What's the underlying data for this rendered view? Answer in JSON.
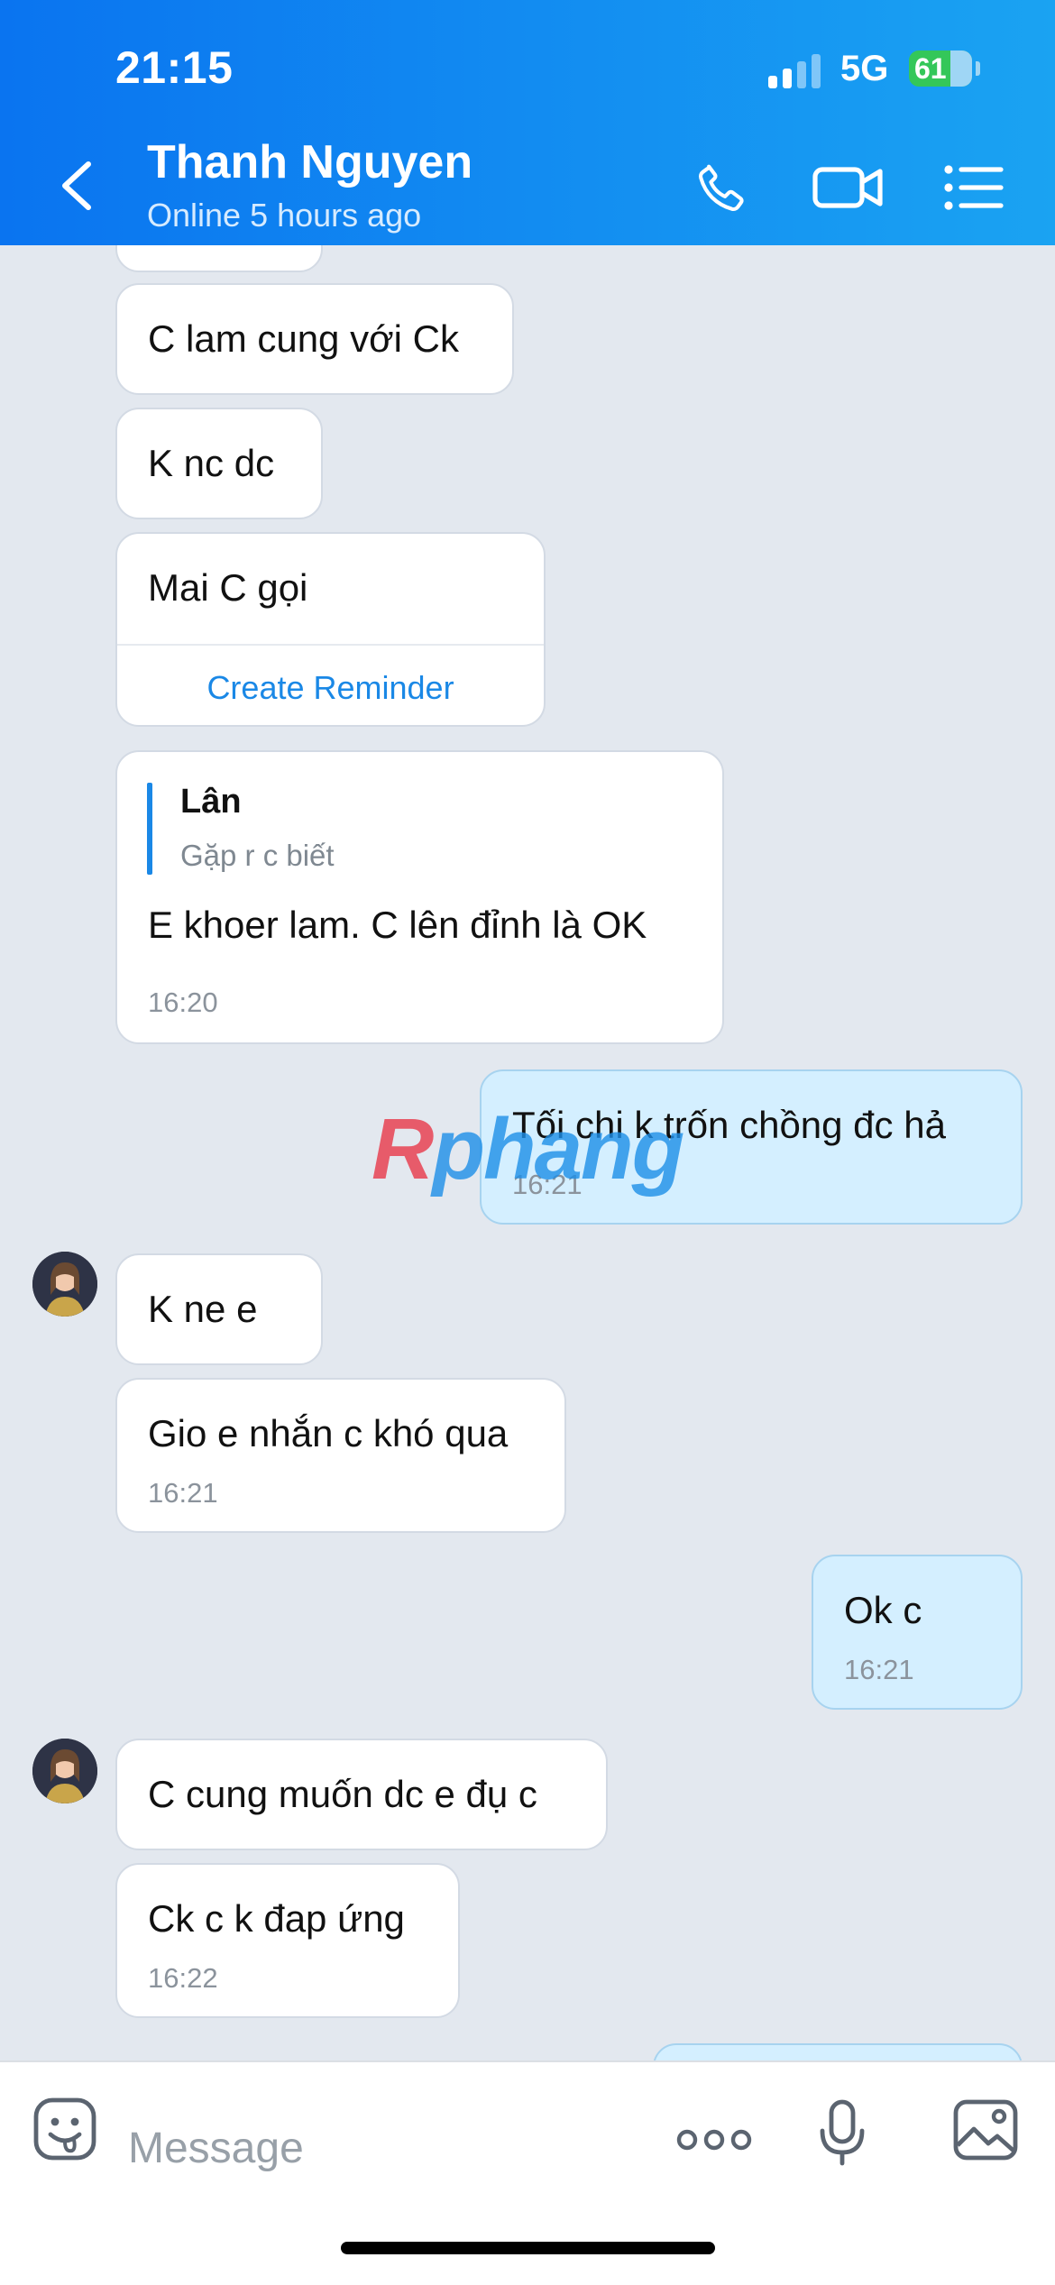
{
  "status_bar": {
    "time": "21:15",
    "network": "5G",
    "battery": "61"
  },
  "header": {
    "contact_name": "Thanh Nguyen",
    "status": "Online 5 hours ago",
    "icons": [
      "back-icon",
      "phone-icon",
      "video-call-icon",
      "menu-list-icon"
    ]
  },
  "messages": [
    {
      "text": "C lam cung với Ck"
    },
    {
      "text": "K nc dc"
    },
    {
      "text": "Mai C gọi",
      "action": "Create Reminder"
    },
    {
      "quote_name": "Lân",
      "quote_text": "Gặp r c biết",
      "text": "E khoer lam.  C lên đỉnh là OK",
      "time": "16:20"
    },
    {
      "text": "Tối chi k trốn chồng đc hả",
      "time": "16:21"
    },
    {
      "text": "K ne e"
    },
    {
      "text": "Gio e nhắn c khó qua",
      "time": "16:21"
    },
    {
      "text": "Ok c",
      "time": "16:21"
    },
    {
      "text": "C cung muốn dc e đụ c"
    },
    {
      "text": "Ck c k đap ứng",
      "time": "16:22"
    }
  ],
  "watermark": {
    "part1": "R",
    "part2": "phang"
  },
  "input": {
    "placeholder": "Message"
  },
  "colors": {
    "header_start": "#0a74f0",
    "header_end": "#1aa3f2",
    "my_bubble": "#d4efff",
    "link": "#1a88e6",
    "chat_bg": "#e3e8ef"
  }
}
